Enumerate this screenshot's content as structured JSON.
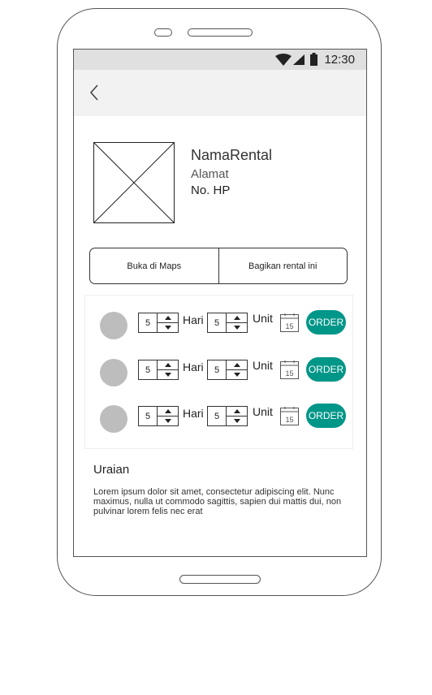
{
  "status_bar": {
    "time": "12:30",
    "icons": [
      "wifi-icon",
      "signal-icon",
      "battery-icon"
    ]
  },
  "app_bar": {
    "back_icon": "chevron-left-icon"
  },
  "rental": {
    "image_placeholder": "image-placeholder-icon",
    "name": "NamaRental",
    "address": "Alamat",
    "phone": "No. HP"
  },
  "actions": {
    "open_maps": "Buka di Maps",
    "share": "Bagikan rental ini"
  },
  "orders": [
    {
      "days": "5",
      "days_label": "Hari",
      "units": "5",
      "units_label": "Unit",
      "calendar_day": "15",
      "order_label": "ORDER"
    },
    {
      "days": "5",
      "days_label": "Hari",
      "units": "5",
      "units_label": "Unit",
      "calendar_day": "15",
      "order_label": "ORDER"
    },
    {
      "days": "5",
      "days_label": "Hari",
      "units": "5",
      "units_label": "Unit",
      "calendar_day": "15",
      "order_label": "ORDER"
    }
  ],
  "description": {
    "title": "Uraian",
    "text": "Lorem ipsum dolor sit amet, consectetur adipiscing elit. Nunc maximus, nulla ut commodo sagittis, sapien dui mattis dui, non pulvinar lorem felis nec erat"
  },
  "colors": {
    "order_button": "#009688",
    "status_bar": "#e0e0e0",
    "app_bar": "#f2f2f2",
    "avatar": "#bdbdbd"
  }
}
